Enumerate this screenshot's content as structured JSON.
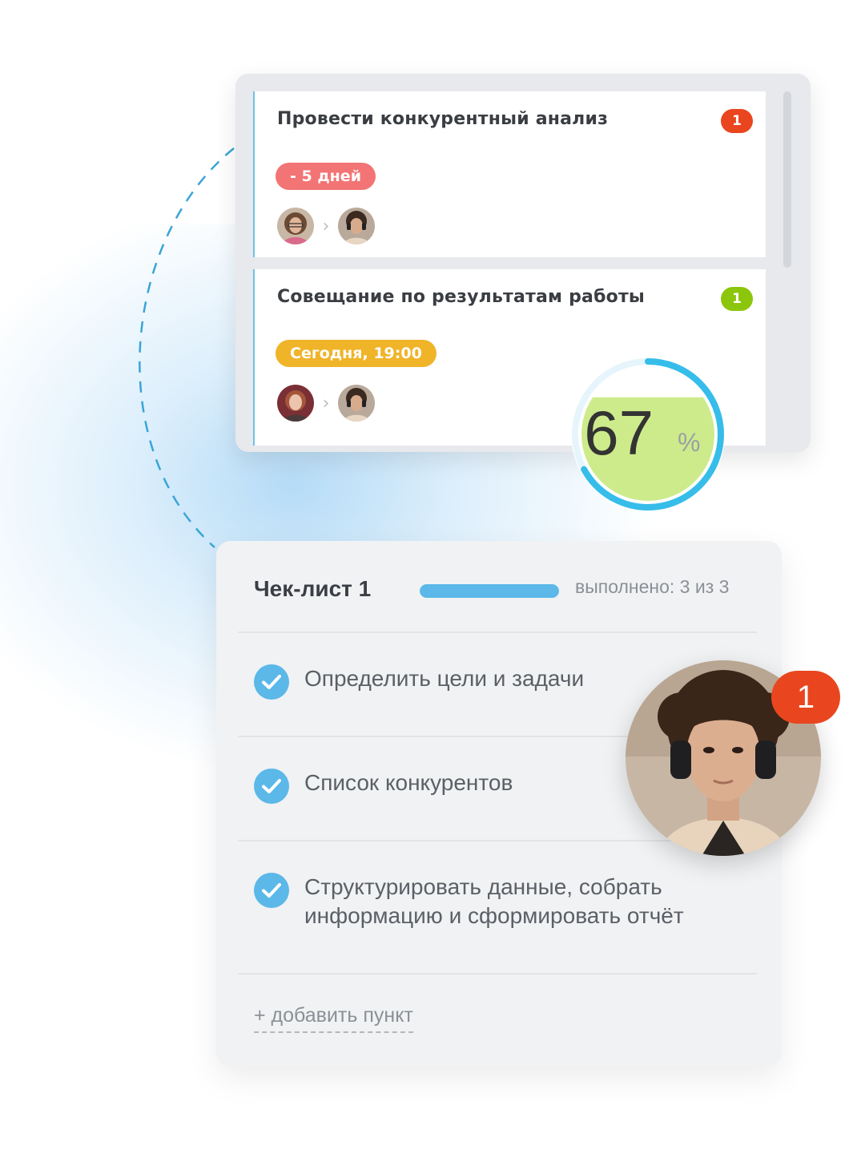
{
  "tasks": [
    {
      "title": "Провести конкурентный анализ",
      "count": "1",
      "count_color": "#e9461f",
      "deadline": "- 5 дней",
      "deadline_color": "#f27474",
      "from_avatar": "avatar-woman-curly",
      "to_avatar": "avatar-man-headphones"
    },
    {
      "title": "Совещание по результатам работы",
      "count": "1",
      "count_color": "#8cc60c",
      "deadline": "Сегодня, 19:00",
      "deadline_color": "#f0b429",
      "from_avatar": "avatar-woman-red-hair",
      "to_avatar": "avatar-man-headphones"
    }
  ],
  "percent": {
    "value": "67",
    "unit": "%",
    "fraction": 0.67
  },
  "checklist": {
    "title": "Чек-лист 1",
    "status": "выполнено: 3 из 3",
    "done": 3,
    "total": 3,
    "items": [
      {
        "text": "Определить цели и задачи",
        "checked": true
      },
      {
        "text": "Список конкурентов",
        "checked": true
      },
      {
        "text": "Структурировать данные, собрать информацию и сформировать отчёт",
        "checked": true
      }
    ],
    "add_label": "+ добавить пункт"
  },
  "assignee": {
    "avatar": "avatar-man-headphones",
    "badge": "1",
    "badge_color": "#e9461f"
  },
  "colors": {
    "accent": "#5bb8e8",
    "ring": "#36bde9",
    "ring_fill": "#cdeb8b"
  }
}
